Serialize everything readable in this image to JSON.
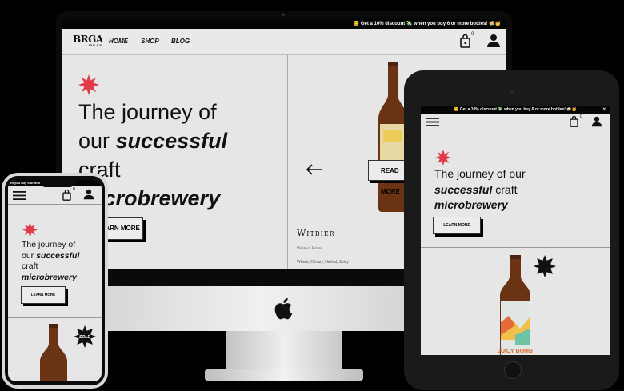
{
  "promo_text": "😊 Get a 10% discount 💸 when you buy 6 or more bottles! 🍻🥳",
  "tablet_promo_text": "😊 Get a 10% discount 💸 when you buy 6 or more bottles! 🍻🥳",
  "phone_promo_text": "ith you buy 6 or more bottles!",
  "brand": {
    "logo_text": "BRGA",
    "logo_sub": "MEAD"
  },
  "nav": {
    "home": "HOME",
    "shop": "SHOP",
    "blog": "BLOG"
  },
  "cart": {
    "count": "0"
  },
  "hero": {
    "line1": "The journey of",
    "line2_strong": "successful",
    "line2_prefix": "our ",
    "line3": "craft",
    "line4": "microbrewery",
    "button": "LEARN MORE"
  },
  "tablet_hero": {
    "line1": "The journey of our",
    "strong1": "successful",
    "craft": " craft",
    "strong2": "microbrewery"
  },
  "phone_hero": {
    "line1": "The journey of",
    "our": "our ",
    "strong1": "successful",
    "craft": "craft",
    "strong2": "microbrewery"
  },
  "product": {
    "name": "Witbier",
    "style": "Wheat Beer",
    "tags": "Wheat, Citrusy, Herbal, Spicy",
    "read_more": "READ MORE",
    "label_text": "JUICY BOMB"
  },
  "sold_badge": "SOLD",
  "tablet_close": "×",
  "colors": {
    "accent_star": "#e23a48",
    "bottle": "#6a3414",
    "screen_bg": "#e6e6e6",
    "promo_bg": "#050505"
  }
}
